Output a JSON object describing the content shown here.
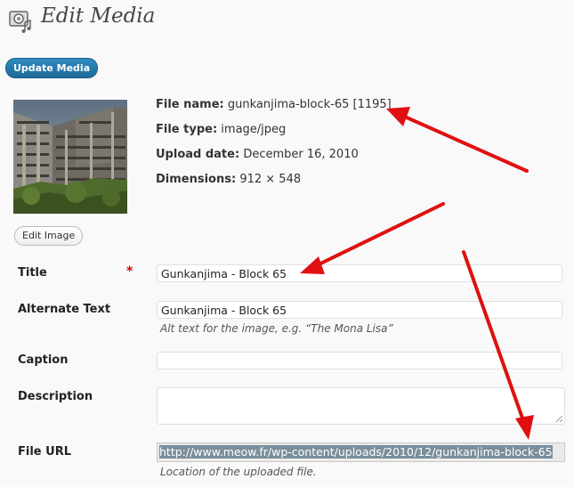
{
  "header": {
    "title": "Edit Media"
  },
  "toolbar": {
    "update_label": "Update Media"
  },
  "thumbnail": {
    "edit_label": "Edit Image"
  },
  "meta": {
    "file_name_label": "File name:",
    "file_name_value": "gunkanjima-block-65 [1195]",
    "file_type_label": "File type:",
    "file_type_value": "image/jpeg",
    "upload_date_label": "Upload date:",
    "upload_date_value": "December 16, 2010",
    "dimensions_label": "Dimensions:",
    "dimensions_value": "912 × 548"
  },
  "form": {
    "title_label": "Title",
    "required_mark": "*",
    "title_value": "Gunkanjima - Block 65",
    "alt_label": "Alternate Text",
    "alt_value": "Gunkanjima - Block 65",
    "alt_help": "Alt text for the image, e.g. “The Mona Lisa”",
    "caption_label": "Caption",
    "caption_value": "",
    "description_label": "Description",
    "description_value": "",
    "file_url_label": "File URL",
    "file_url_value": "http://www.meow.fr/wp-content/uploads/2010/12/gunkanjima-block-65",
    "file_url_help": "Location of the uploaded file."
  },
  "colors": {
    "accent": "#21759b",
    "arrow": "#e01010",
    "required": "#d20000"
  }
}
